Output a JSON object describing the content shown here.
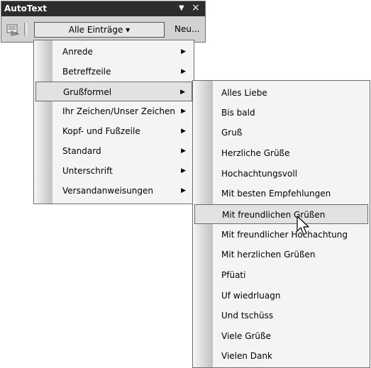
{
  "toolbar": {
    "title": "AutoText",
    "dropdown_glyph": "▼",
    "close_glyph": "×",
    "entries_button_label": "Alle Einträge ▾",
    "new_button_label": "Neu..."
  },
  "menu": {
    "items": [
      {
        "label": "Anrede",
        "arrow": "▶"
      },
      {
        "label": "Betreffzeile",
        "arrow": "▶"
      },
      {
        "label": "Grußformel",
        "arrow": "▶"
      },
      {
        "label": "Ihr Zeichen/Unser Zeichen",
        "arrow": "▶"
      },
      {
        "label": "Kopf- und Fußzeile",
        "arrow": "▶"
      },
      {
        "label": "Standard",
        "arrow": "▶"
      },
      {
        "label": "Unterschrift",
        "arrow": "▶"
      },
      {
        "label": "Versandanweisungen",
        "arrow": "▶"
      }
    ],
    "highlighted": "Grußformel"
  },
  "submenu": {
    "items": [
      "Alles Liebe",
      "Bis bald",
      "Gruß",
      "Herzliche Grüße",
      "Hochachtungsvoll",
      "Mit besten Empfehlungen",
      "Mit freundlichen Grüßen",
      "Mit freundlicher Hochachtung",
      "Mit herzlichen Grüßen",
      "Pfüati",
      "Uf wiedrluagn",
      "Und tschüss",
      "Viele Grüße",
      "Vielen Dank"
    ],
    "highlighted": "Mit freundlichen Grüßen"
  }
}
